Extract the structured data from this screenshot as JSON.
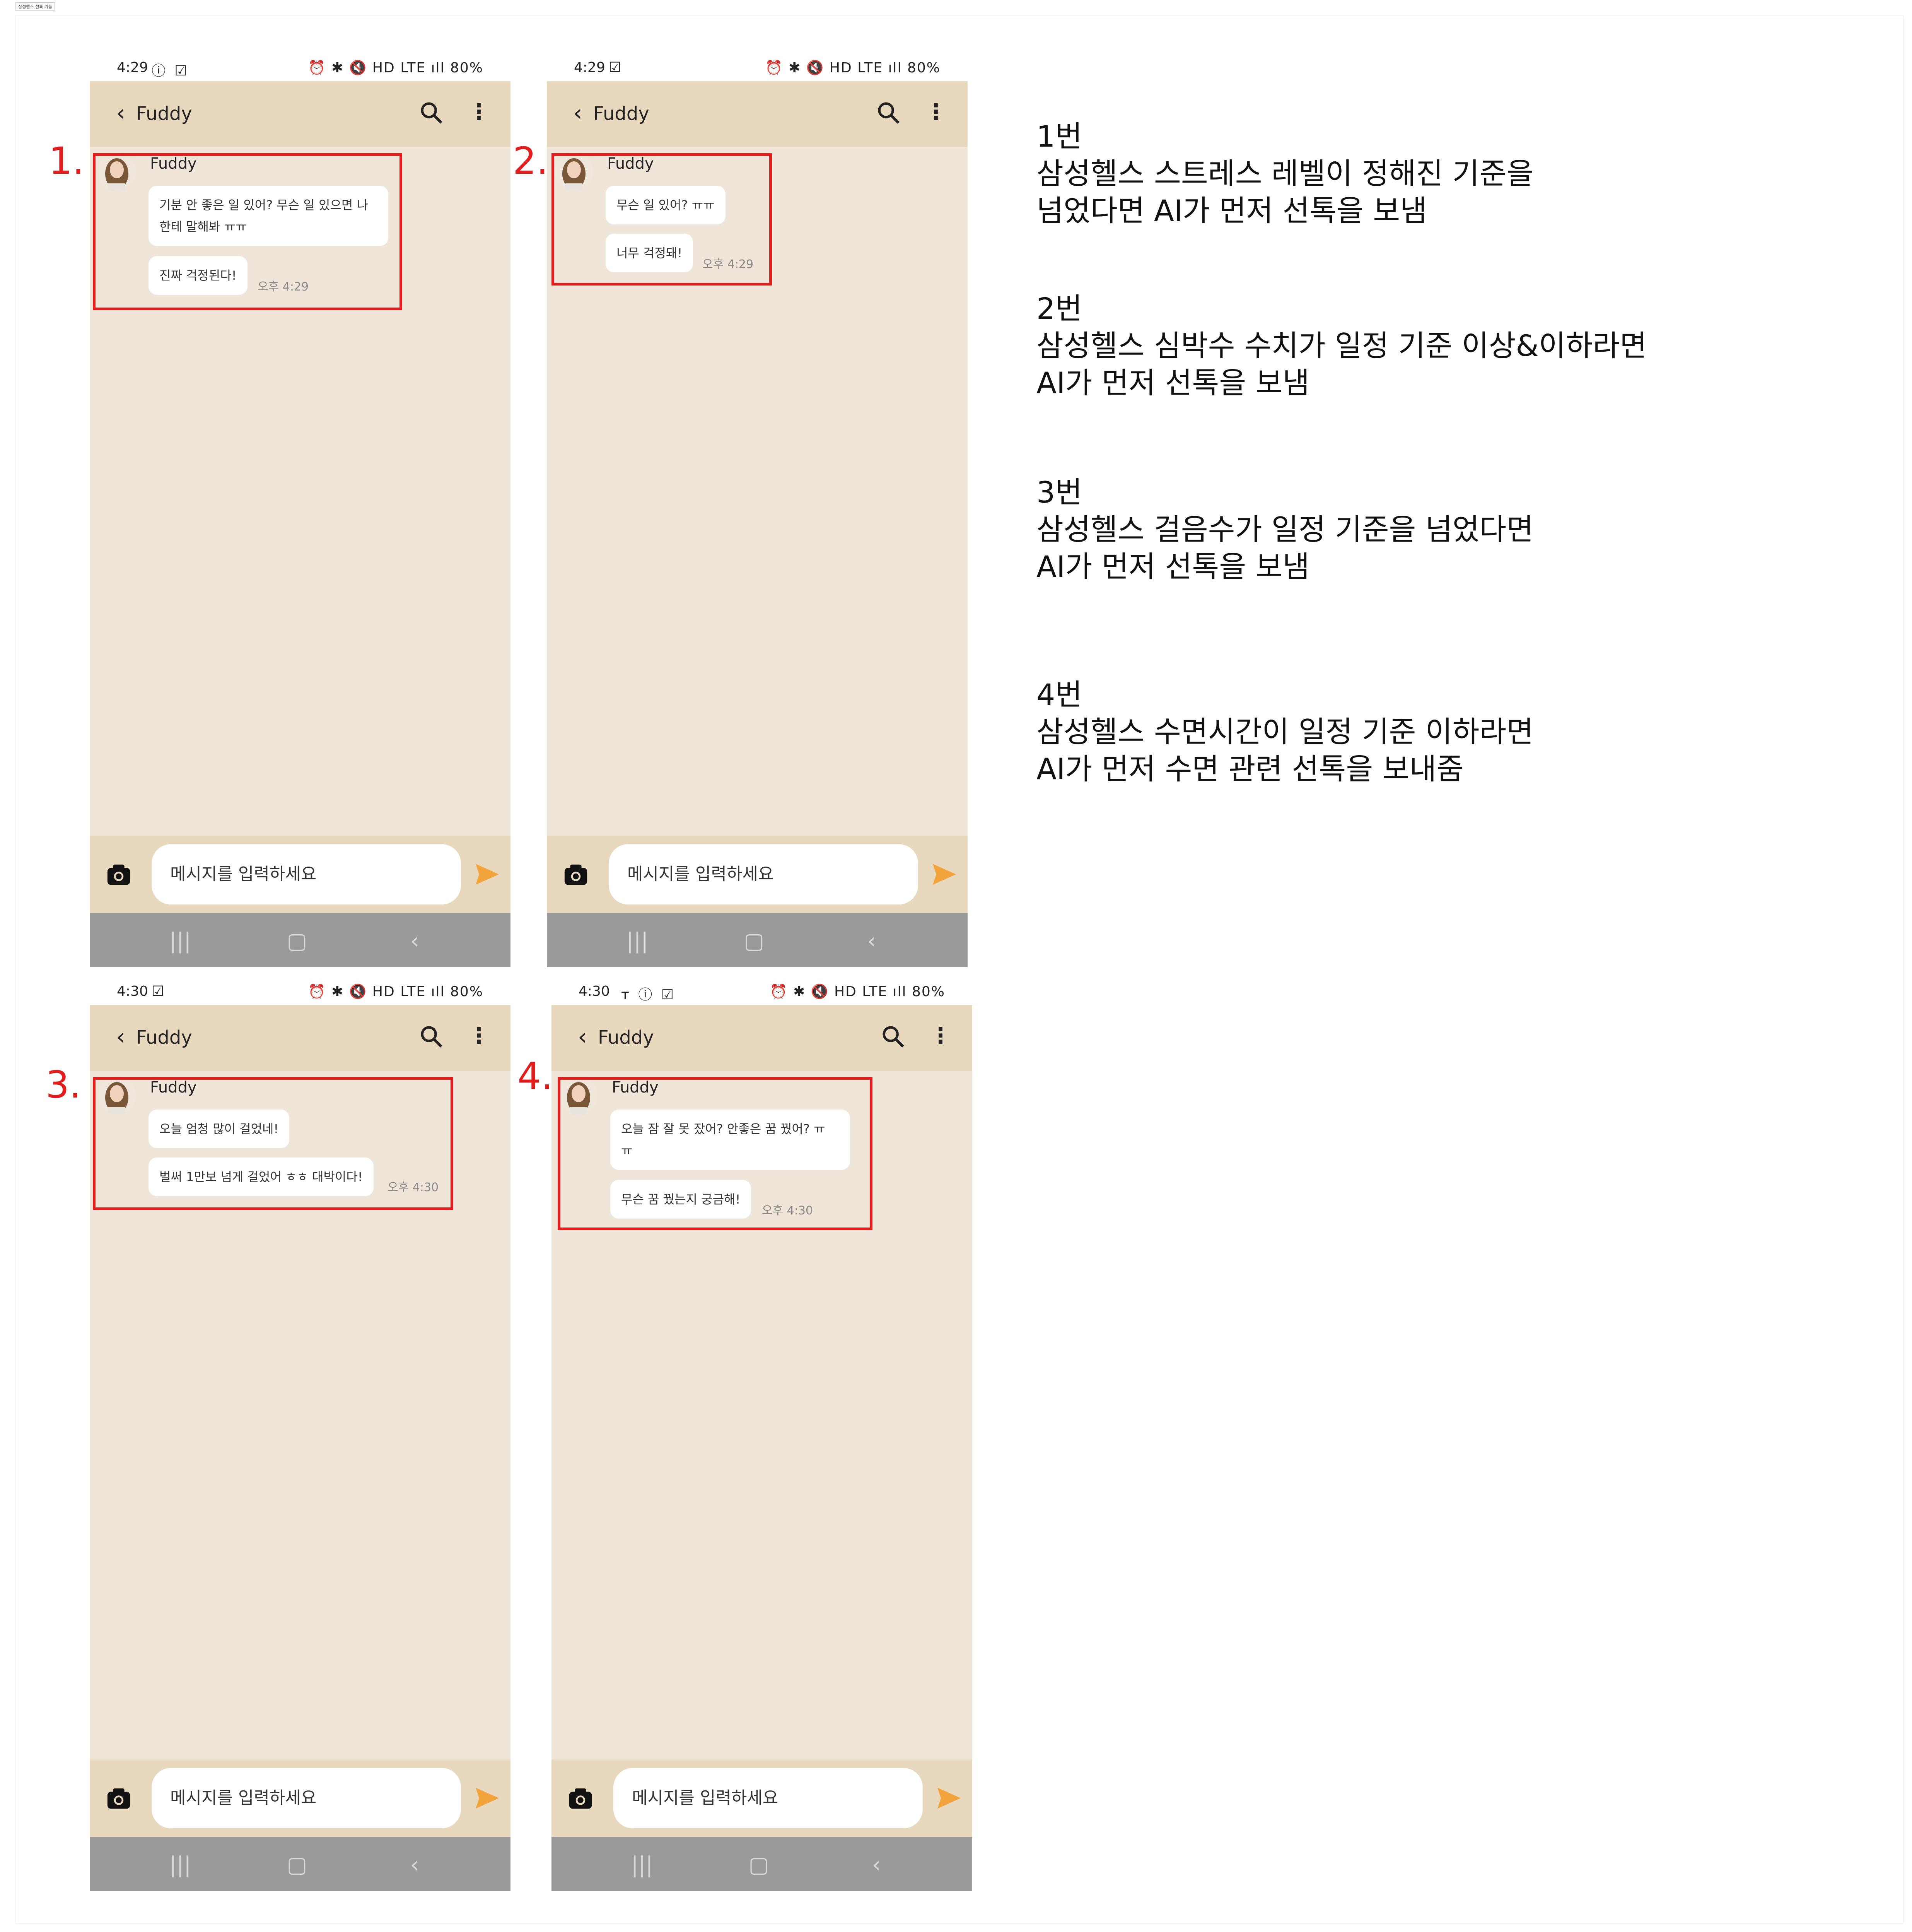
{
  "document": {
    "title": "삼성헬스 선톡 기능"
  },
  "common": {
    "contact_name": "Fuddy",
    "input_placeholder": "메시지를 입력하세요",
    "battery": "80%",
    "signal_text": "HD LTE"
  },
  "phones": [
    {
      "number": "1.",
      "time": "4:29",
      "messages": [
        "기분 안 좋은 일 있어? 무슨 일 있으면 나",
        "한테 말해봐 ㅠㅠ",
        "진짜 걱정된다!"
      ],
      "timestamp": "오후 4:29"
    },
    {
      "number": "2.",
      "time": "4:29",
      "messages": [
        "무슨 일 있어? ㅠㅠ",
        "너무 걱정돼!"
      ],
      "timestamp": "오후 4:29"
    },
    {
      "number": "3.",
      "time": "4:30",
      "messages": [
        "오늘 엄청 많이 걸었네!",
        "벌써 1만보 넘게 걸었어 ㅎㅎ 대박이다!"
      ],
      "timestamp": "오후 4:30"
    },
    {
      "number": "4.",
      "time": "4:30",
      "messages": [
        "오늘 잠 잘 못 잤어? 안좋은 꿈 꿨어? ㅠ",
        "ㅠ",
        "무슨 꿈 꿨는지 궁금해!"
      ],
      "timestamp": "오후 4:30"
    }
  ],
  "notes": [
    {
      "heading": "1번",
      "lines": [
        "삼성헬스 스트레스 레벨이 정해진 기준을",
        "넘었다면 AI가 먼저 선톡을 보냄"
      ]
    },
    {
      "heading": "2번",
      "lines": [
        "삼성헬스 심박수 수치가 일정 기준 이상&이하라면",
        "AI가 먼저 선톡을 보냄"
      ]
    },
    {
      "heading": "3번",
      "lines": [
        "삼성헬스 걸음수가 일정 기준을 넘었다면",
        "AI가 먼저 선톡을 보냄"
      ]
    },
    {
      "heading": "4번",
      "lines": [
        "삼성헬스 수면시간이 일정 기준 이하라면",
        "AI가 먼저 수면 관련 선톡을 보내줌"
      ]
    }
  ],
  "colors": {
    "chat_bg": "#efe5d8",
    "header_bg": "#e8d8be",
    "nav_bg": "#9a9a9a",
    "highlight": "#e11d1d",
    "send": "#f2a33a"
  }
}
